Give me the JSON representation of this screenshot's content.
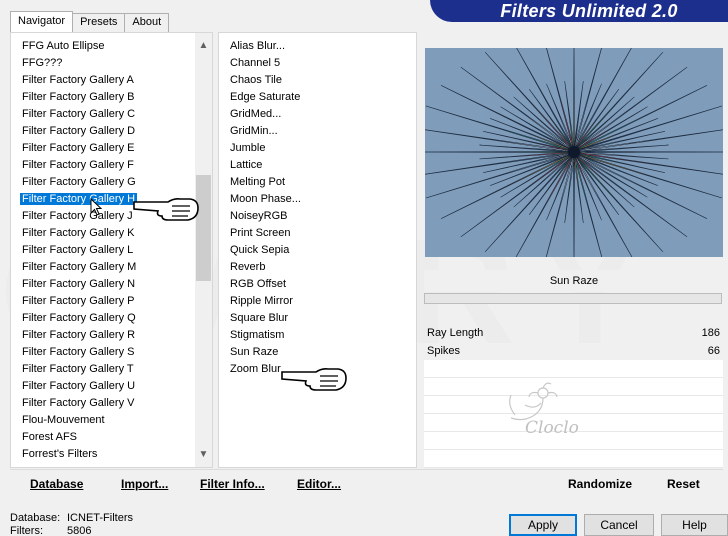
{
  "app": {
    "title": "Filters Unlimited 2.0"
  },
  "tabs": [
    {
      "label": "Navigator",
      "active": true
    },
    {
      "label": "Presets",
      "active": false
    },
    {
      "label": "About",
      "active": false
    }
  ],
  "categories": {
    "selected_index": 9,
    "items": [
      "FFG Auto Ellipse",
      "FFG???",
      "Filter Factory Gallery A",
      "Filter Factory Gallery B",
      "Filter Factory Gallery C",
      "Filter Factory Gallery D",
      "Filter Factory Gallery E",
      "Filter Factory Gallery F",
      "Filter Factory Gallery G",
      "Filter Factory Gallery H",
      "Filter Factory Gallery J",
      "Filter Factory Gallery K",
      "Filter Factory Gallery L",
      "Filter Factory Gallery M",
      "Filter Factory Gallery N",
      "Filter Factory Gallery P",
      "Filter Factory Gallery Q",
      "Filter Factory Gallery R",
      "Filter Factory Gallery S",
      "Filter Factory Gallery T",
      "Filter Factory Gallery U",
      "Filter Factory Gallery V",
      "Flou-Mouvement",
      "Forest AFS",
      "Forrest's Filters"
    ],
    "scroll_position": 0.42
  },
  "filters": {
    "selected_index": 16,
    "items": [
      "Alias Blur...",
      "Channel 5",
      "Chaos Tile",
      "Edge Saturate",
      "GridMed...",
      "GridMin...",
      "Jumble",
      "Lattice",
      "Melting Pot",
      "Moon Phase...",
      "NoiseyRGB",
      "Print Screen",
      "Quick Sepia",
      "Reverb",
      "RGB Offset",
      "Ripple Mirror",
      "Square Blur",
      "Stigmatism",
      "Sun Raze",
      "Zoom Blur"
    ]
  },
  "current_filter": {
    "name": "Sun Raze",
    "params": [
      {
        "label": "Ray Length",
        "value": "186"
      },
      {
        "label": "Spikes",
        "value": "66"
      }
    ]
  },
  "toolbar": {
    "database": "Database",
    "import": "Import...",
    "filter_info": "Filter Info...",
    "editor": "Editor...",
    "randomize": "Randomize",
    "reset": "Reset"
  },
  "status": {
    "database_label": "Database:",
    "database_value": "ICNET-Filters",
    "filters_label": "Filters:",
    "filters_value": "5806"
  },
  "buttons": {
    "apply": "Apply",
    "cancel": "Cancel",
    "help": "Help"
  },
  "watermark": {
    "signature": "Cloclo"
  },
  "colors": {
    "banner": "#1c2f8c",
    "selection": "#0078d7"
  }
}
